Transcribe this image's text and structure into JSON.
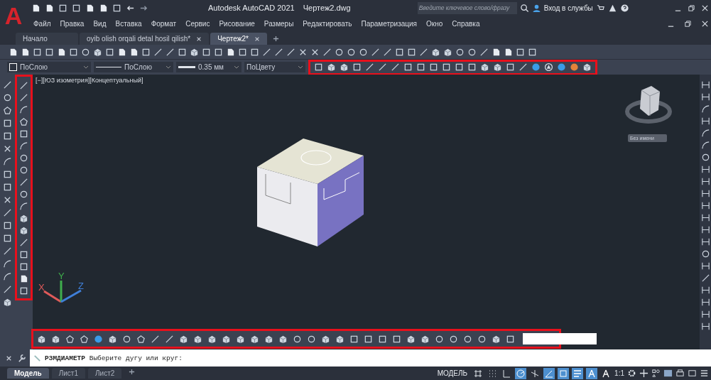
{
  "logo": "A",
  "window": {
    "app_title": "Autodesk AutoCAD 2021",
    "file_name": "Чертеж2.dwg"
  },
  "search": {
    "placeholder": "Введите ключевое слово/фразу"
  },
  "sign_in": "Вход в службы",
  "menu": [
    "Файл",
    "Правка",
    "Вид",
    "Вставка",
    "Формат",
    "Сервис",
    "Рисование",
    "Размеры",
    "Редактировать",
    "Параметризация",
    "Окно",
    "Справка"
  ],
  "doc_tabs": [
    {
      "label": "Начало",
      "selected": false,
      "closable": false
    },
    {
      "label": "oyib olish orqali detal hosil qilish*",
      "selected": false,
      "closable": true
    },
    {
      "label": "Чертеж2*",
      "selected": true,
      "closable": true
    }
  ],
  "properties": {
    "layer": "ПоСлою",
    "linetype": "ПоСлою",
    "lineweight": "0.35 мм",
    "plotstyle": "ПоЦвету"
  },
  "viewport": {
    "label": "[−][ЮЗ изометрия][Концептуальный]",
    "named_view": "Без имени",
    "axes": [
      "X",
      "Y",
      "Z"
    ]
  },
  "command": {
    "name": "РЗМДИАМЕТР",
    "prompt": "Выберите дугу или круг:"
  },
  "layout_tabs": [
    {
      "label": "Модель",
      "selected": true
    },
    {
      "label": "Лист1",
      "selected": false
    },
    {
      "label": "Лист2",
      "selected": false
    }
  ],
  "status": {
    "model": "МОДЕЛЬ",
    "scale": "1:1"
  },
  "status_toggles": [
    {
      "kind": "grid",
      "on": false
    },
    {
      "kind": "snap",
      "on": false
    },
    {
      "kind": "ortho",
      "on": false
    },
    {
      "kind": "polar",
      "on": true
    },
    {
      "kind": "isodraft",
      "on": false
    },
    {
      "kind": "angle",
      "on": true
    },
    {
      "kind": "osnap",
      "on": true
    },
    {
      "kind": "lineweight",
      "on": true
    },
    {
      "kind": "annotation",
      "on": true
    },
    {
      "kind": "autoscale",
      "on": false
    }
  ]
}
